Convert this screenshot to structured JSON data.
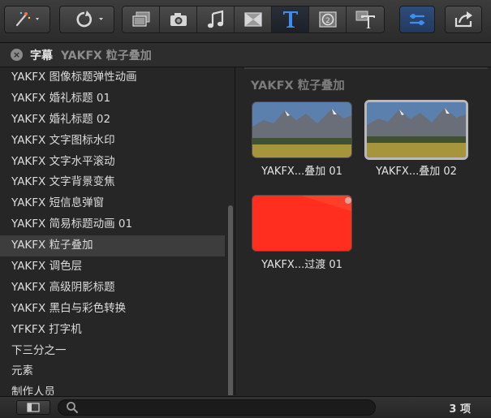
{
  "header": {
    "category": "字幕",
    "selection": "YAKFX 粒子叠加"
  },
  "sidebar": {
    "items": [
      {
        "label": "YAKFX 图像标题弹性动画"
      },
      {
        "label": "YAKFX 婚礼标题 01"
      },
      {
        "label": "YAKFX 婚礼标题 02"
      },
      {
        "label": "YAKFX 文字图标水印"
      },
      {
        "label": "YAKFX 文字水平滚动"
      },
      {
        "label": "YAKFX 文字背景变焦"
      },
      {
        "label": "YAKFX 短信息弹窗"
      },
      {
        "label": "YAKFX 简易标题动画 01"
      },
      {
        "label": "YAKFX 粒子叠加"
      },
      {
        "label": "YAKFX 调色层"
      },
      {
        "label": "YAKFX 高级阴影标题"
      },
      {
        "label": "YAKFX 黑白与彩色转换"
      },
      {
        "label": "YFKFX 打字机"
      },
      {
        "label": "下三分之一"
      },
      {
        "label": "元素"
      },
      {
        "label": "制作人员"
      }
    ],
    "selected_index": 8
  },
  "content": {
    "title": "YAKFX 粒子叠加",
    "thumbnails": [
      {
        "label": "YAKFX...叠加 01"
      },
      {
        "label": "YAKFX...叠加 02"
      },
      {
        "label": "YAKFX...过渡 01"
      }
    ]
  },
  "footer": {
    "count": "3 项"
  },
  "colors": {
    "accent": "#3d8ef0",
    "selected_row": "#3d3d3d",
    "thumb_red": "#ff2e1f"
  }
}
